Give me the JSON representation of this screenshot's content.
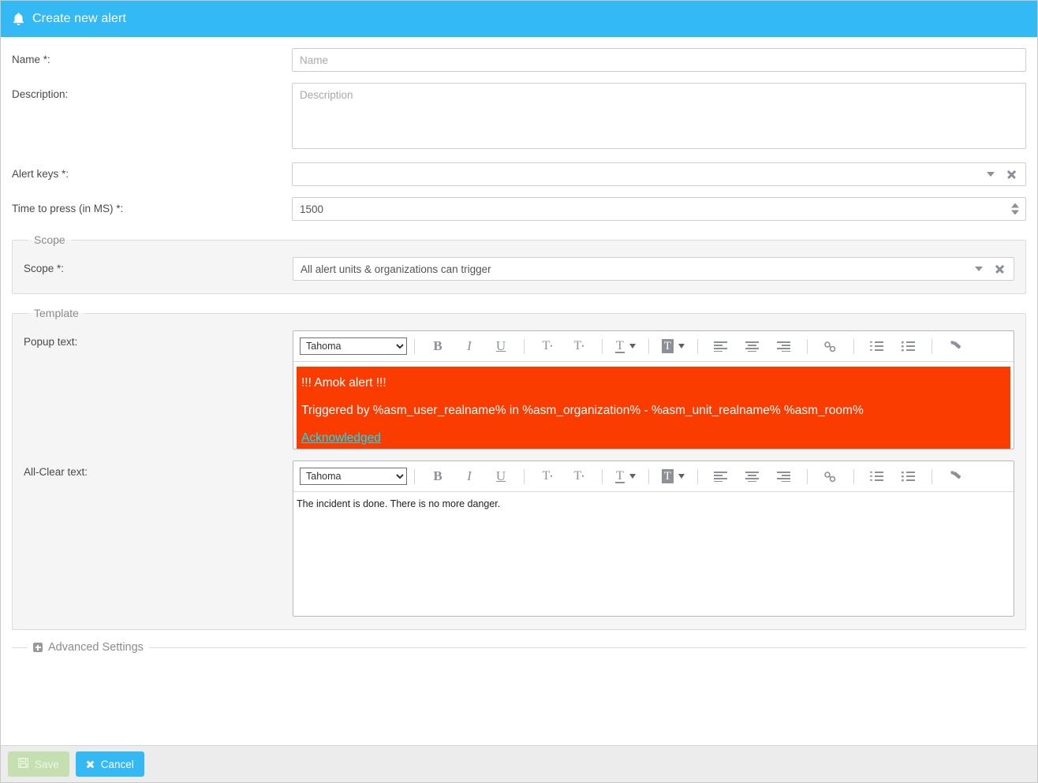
{
  "header": {
    "title": "Create new alert",
    "icon": "bell-icon",
    "background": "#33baf5"
  },
  "form": {
    "name": {
      "label": "Name *:",
      "value": "",
      "placeholder": "Name"
    },
    "description": {
      "label": "Description:",
      "value": "",
      "placeholder": "Description"
    },
    "alert_keys": {
      "label": "Alert keys *:",
      "value": "",
      "caret_icon": "chevron-down-icon",
      "clear_icon": "close-icon"
    },
    "time_to_press": {
      "label": "Time to press (in MS) *:",
      "value": "1500",
      "spinner_icon": "spinner-updown-icon"
    }
  },
  "scope": {
    "legend": "Scope",
    "field": {
      "label": "Scope *:",
      "value": "All alert units & organizations can trigger",
      "caret_icon": "chevron-down-icon",
      "clear_icon": "close-icon"
    }
  },
  "template": {
    "legend": "Template",
    "popup": {
      "label": "Popup text:",
      "toolbar": {
        "font_value": "Tahoma",
        "font_options": [
          "Tahoma"
        ],
        "buttons": [
          {
            "name": "bold-icon",
            "label": "B"
          },
          {
            "name": "italic-icon",
            "label": "I"
          },
          {
            "name": "underline-icon",
            "label": "U"
          },
          {
            "name": "superscript-icon",
            "label": "T"
          },
          {
            "name": "subscript-icon",
            "label": "T"
          },
          {
            "name": "text-color-icon",
            "label": "T"
          },
          {
            "name": "highlight-color-icon",
            "label": "T"
          },
          {
            "name": "align-left-icon",
            "label": ""
          },
          {
            "name": "align-center-icon",
            "label": ""
          },
          {
            "name": "align-right-icon",
            "label": ""
          },
          {
            "name": "link-icon",
            "label": ""
          },
          {
            "name": "numbered-list-icon",
            "label": ""
          },
          {
            "name": "bullet-list-icon",
            "label": ""
          },
          {
            "name": "remove-format-icon",
            "label": ""
          }
        ]
      },
      "content": {
        "line1": "!!! Amok alert !!!",
        "line2": "Triggered by %asm_user_realname% in %asm_organization% - %asm_unit_realname% %asm_room%",
        "line3": "Acknowledged",
        "highlight_color": "#fa3c00",
        "text_color": "#ffffff",
        "link_color": "#00e5ff"
      }
    },
    "allclear": {
      "label": "All-Clear text:",
      "toolbar": {
        "font_value": "Tahoma",
        "font_options": [
          "Tahoma"
        ]
      },
      "content": {
        "line1": "The incident is done. There is no more danger."
      }
    }
  },
  "advanced": {
    "legend": "Advanced Settings",
    "expand_icon": "plus-box-icon"
  },
  "footer": {
    "save_label": "Save",
    "save_icon": "floppy-disk-icon",
    "cancel_label": "Cancel",
    "cancel_icon": "close-icon"
  }
}
